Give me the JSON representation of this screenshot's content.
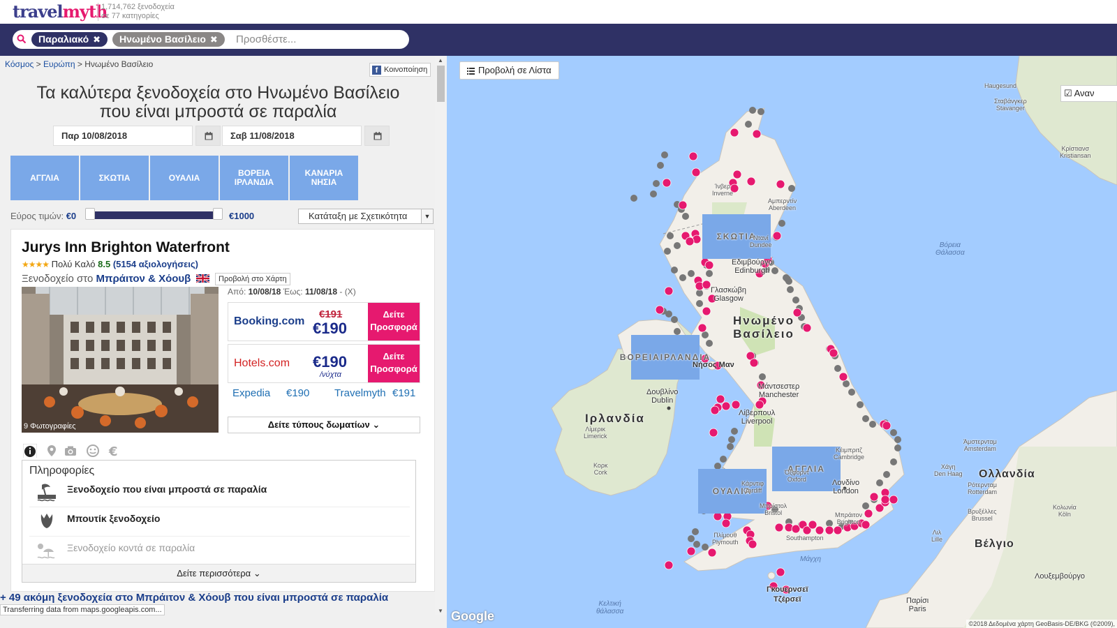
{
  "header": {
    "logo_main": "travel",
    "logo_accent": "myth",
    "stats_line1": "1,714,762 ξενοδοχεία",
    "stats_line2": "σε 77 κατηγορίες"
  },
  "search": {
    "chips": [
      "Παραλιακό",
      "Ηνωμένο Βασίλειο"
    ],
    "placeholder": "Προσθέστε..."
  },
  "breadcrumb": {
    "world": "Κόσμος",
    "europe": "Ευρώπη",
    "current": "Ηνωμένο Βασίλειο",
    "sep": ">"
  },
  "share_label": "Κοινοποίηση",
  "page_title_line1": "Τα καλύτερα ξενοδοχεία στο Ηνωμένο Βασίλειο",
  "page_title_line2": "που είναι μπροστά σε παραλία",
  "dates": {
    "from": "Παρ 10/08/2018",
    "to": "Σαβ 11/08/2018"
  },
  "regions": [
    "ΑΓΓΛΙΑ",
    "ΣΚΩΤΙΑ",
    "ΟΥΑΛΙΑ",
    "ΒΟΡΕΙΑ ΙΡΛΑΝΔΙΑ",
    "ΚΑΝΑΡΙΑ ΝΗΣΙΑ"
  ],
  "price_filter": {
    "label": "Εύρος τιμών:",
    "min": "€0",
    "max": "€1000",
    "min_value": 0,
    "max_value": 1000
  },
  "sort": {
    "selected": "Κατάταξη με Σχετικότητα"
  },
  "hotel": {
    "name": "Jurys Inn Brighton Waterfront",
    "stars": 4,
    "stars_text": "★★★★",
    "rating_text": "Πολύ Καλό",
    "score": "8.5",
    "reviews": "(5154 αξιολογήσεις)",
    "location_prefix": "Ξενοδοχείο στο",
    "city": "Μπράιτον & Χόουβ",
    "map_view_label": "Προβολή στο Χάρτη",
    "photo_count": "9 Φωτογραφίες",
    "dates_prefix": "Από:",
    "date_from": "10/08/18",
    "dates_mid": "Έως:",
    "date_to": "11/08/18",
    "dates_clear": "- (X)",
    "offers": [
      {
        "provider": "Booking.com",
        "old_price": "€191",
        "price": "€190",
        "deal_label": "Δείτε Προσφορά"
      },
      {
        "provider": "Hotels.com",
        "price": "€190",
        "per_night": "/νύχτα",
        "deal_label": "Δείτε Προσφορά"
      }
    ],
    "other_offers": [
      {
        "provider": "Expedia",
        "price": "€190"
      },
      {
        "provider": "Travelmyth",
        "price": "€191"
      }
    ],
    "room_types_label": "Δείτε τύπους δωματίων",
    "info_title": "Πληροφορίες",
    "features": [
      "Ξενοδοχείο που είναι μπροστά σε παραλία",
      "Μπουτίκ ξενοδοχείο",
      "Ξενοδοχείο κοντά σε παραλία"
    ],
    "see_more_label": "Δείτε περισσότερα"
  },
  "more_hotels": "+ 49 ακόμη ξενοδοχεία στο Μπράιτον & Χόουβ που είναι μπροστά σε παραλία",
  "status_text": "Transferring data from maps.googleapis.com...",
  "map": {
    "list_view_label": "Προβολή σε Λίστα",
    "redo_search_label": "Αναν",
    "labels": {
      "uk_line1": "Ηνωμένο",
      "uk_line2": "Βασίλειο",
      "ireland": "Ιρλανδία",
      "scotland": "ΣΚΩΤΙΑ",
      "england": "ΑΓΓΛΙΑ",
      "wales": "ΟΥΑΛΙΑ",
      "northern_ireland_line1": "ΒΟΡΕΙΑ",
      "northern_ireland_line2": "ΙΡΛΑΝΔΙΑ",
      "isle_of_man": "Νήσος Μαν",
      "north_sea_line1": "Βόρεια",
      "north_sea_line2": "Θάλασσα",
      "celtic_line1": "Κελτική",
      "celtic_line2": "θάλασσα",
      "channel": "Μάγχη",
      "netherlands": "Ολλανδία",
      "belgium": "Βέλγιο",
      "luxembourg": "Λουξεμβούργο",
      "guernsey_line1": "Γκουερνσεϊ",
      "guernsey_line2": "Τζέρσεϊ",
      "aberdeen_line1": "Αμπερντίν",
      "aberdeen_line2": "Aberdeen",
      "dundee_line1": "Ντανί",
      "dundee_line2": "Dundee",
      "edinburgh_line1": "Εδιμβούργο",
      "edinburgh_line2": "Edinburgh",
      "glasgow_line1": "Γλασκώβη",
      "glasgow_line2": "Glasgow",
      "inverness_line1": "Ίνβερ",
      "inverness_line2": "Inverne",
      "manchester_line1": "Μάντσεστερ",
      "manchester_line2": "Manchester",
      "liverpool_line1": "Λίβερπουλ",
      "liverpool_line2": "Liverpool",
      "dublin_line1": "Δουβλίνο",
      "dublin_line2": "Dublin",
      "limerick_line1": "Λίμερικ",
      "limerick_line2": "Limerick",
      "cork_line1": "Κορκ",
      "cork_line2": "Cork",
      "cambridge_line1": "Κέιμπριτζ",
      "cambridge_line2": "Cambridge",
      "oxford_line1": "Όξφορντ",
      "oxford_line2": "Oxford",
      "london_line1": "Λονδίνο",
      "london_line2": "London",
      "cardiff_line1": "Κάρντιφ",
      "cardiff_line2": "Cardiff",
      "bristol_line1": "Μπρίστολ",
      "bristol_line2": "Bristol",
      "brighton_line1": "Μπράιτον",
      "brighton_line2": "Brighton",
      "southampton": "Southampton",
      "plymouth_line1": "Πλίμουθ",
      "plymouth_line2": "Plymouth",
      "amsterdam_line1": "Άμστερνταμ",
      "amsterdam_line2": "Amsterdam",
      "haag_line1": "Χάγη",
      "haag_line2": "Den Haag",
      "rotterdam_line1": "Ρότερνταμ",
      "rotterdam_line2": "Rotterdam",
      "brussels_line1": "Βρυξέλλες",
      "brussels_line2": "Brussel",
      "koln_line1": "Κολωνία",
      "koln_line2": "Köln",
      "lille_line1": "Λιλ",
      "lille_line2": "Lille",
      "paris_line1": "Παρίσι",
      "paris_line2": "Paris",
      "haugesund": "Haugesund",
      "stavanger_line1": "Σταβάνγκερ",
      "stavanger_line2": "Stavanger",
      "kristiansand_line1": "Κρίστιανσ",
      "kristiansand_line2": "Kristiansan"
    },
    "google": "Google",
    "attribution": "©2018 Δεδομένα χάρτη GeoBasis-DE/BKG (©2009),"
  }
}
